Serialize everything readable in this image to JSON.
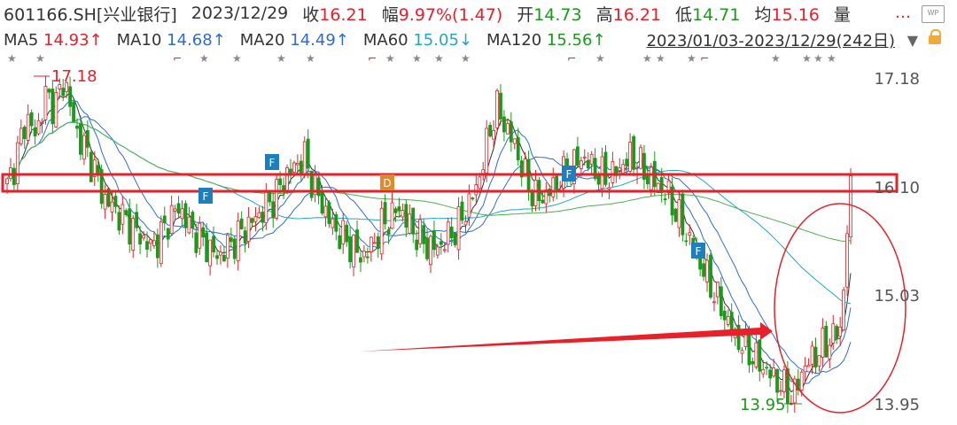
{
  "header": {
    "code": "601166.SH[兴业银行]",
    "date": "2023/12/29",
    "close_label": "收",
    "close": "16.21",
    "change_label": "幅",
    "change": "9.97%(1.47)",
    "open_label": "开",
    "open": "14.73",
    "high_label": "高",
    "high": "16.21",
    "low_label": "低",
    "low": "14.71",
    "avg_label": "均",
    "avg": "15.16",
    "vol_label": "量"
  },
  "ma_bar": {
    "ma5_label": "MA5",
    "ma5": "14.93↑",
    "ma10_label": "MA10",
    "ma10": "14.68↑",
    "ma20_label": "MA20",
    "ma20": "14.49↑",
    "ma60_label": "MA60",
    "ma60": "15.05↓",
    "ma120_label": "MA120",
    "ma120": "15.56↑",
    "range": "2023/01/03-2023/12/29(242日)"
  },
  "icons": {
    "menu": "more-dots-icon",
    "wp": "WP",
    "lock": "lock-icon",
    "dropdown": "triangle-down-icon"
  },
  "colors": {
    "up": "#e8202a",
    "down": "#1a9a1a",
    "ma5": "#333333",
    "ma10": "#2d6bd8",
    "ma20": "#2d6bd8",
    "ma60": "#1ea7c8",
    "ma120": "#4caf50",
    "marker_f": "#1e7fbf",
    "marker_d": "#e08a2c"
  },
  "chart_data": {
    "type": "candlestick",
    "ylim": [
      13.95,
      17.18
    ],
    "yticks": [
      "17.18",
      "16.10",
      "15.03",
      "13.95"
    ],
    "annotations": {
      "high": "17.18",
      "low": "13.95"
    },
    "markers": [
      "F",
      "F",
      "D",
      "F",
      "F"
    ],
    "ma_series": [
      "MA5",
      "MA10",
      "MA20",
      "MA60",
      "MA120"
    ],
    "close_path": [
      16.1,
      16.4,
      16.8,
      16.6,
      17.0,
      16.9,
      17.18,
      16.7,
      16.5,
      16.3,
      16.0,
      15.9,
      15.8,
      15.7,
      15.6,
      15.5,
      15.6,
      15.8,
      15.9,
      15.7,
      15.6,
      15.5,
      15.4,
      15.5,
      15.6,
      15.7,
      15.8,
      15.9,
      16.0,
      16.2,
      16.3,
      16.4,
      16.1,
      15.9,
      15.7,
      15.6,
      15.5,
      15.4,
      15.5,
      15.7,
      15.8,
      15.9,
      15.7,
      15.6,
      15.5,
      15.5,
      15.6,
      15.7,
      15.9,
      16.1,
      16.5,
      16.9,
      16.7,
      16.5,
      16.2,
      16.0,
      16.0,
      16.1,
      16.2,
      16.3,
      16.4,
      16.3,
      16.2,
      16.2,
      16.3,
      16.4,
      16.3,
      16.2,
      16.1,
      16.0,
      15.8,
      15.6,
      15.4,
      15.2,
      15.0,
      14.8,
      14.6,
      14.5,
      14.4,
      14.3,
      14.2,
      14.1,
      14.0,
      14.3,
      14.4,
      14.5,
      14.6,
      14.7,
      16.21
    ]
  }
}
